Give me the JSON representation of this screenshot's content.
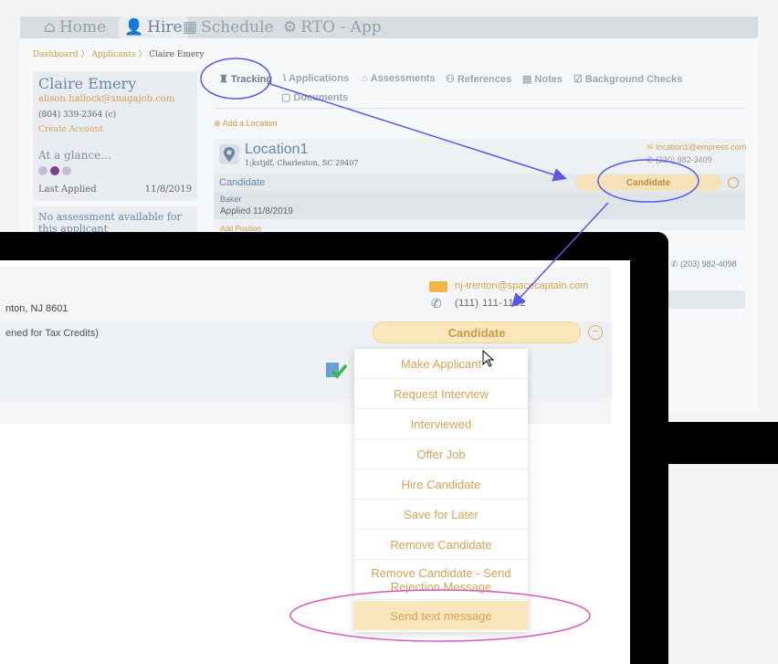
{
  "nav": {
    "home": "Home",
    "hire": "Hire",
    "schedule": "Schedule",
    "rto": "RTO - App"
  },
  "breadcrumb": {
    "dashboard": "Dashboard",
    "applicants": "Applicants",
    "current": "Claire Emery"
  },
  "applicant": {
    "name": "Claire Emery",
    "email": "alison.hallock@snagajob.com",
    "phone": "(804) 339-2364 (c)",
    "create_account": "Create Account",
    "glance": "At a glance...",
    "last_applied_label": "Last Applied",
    "last_applied_date": "11/8/2019",
    "no_assessment": "No assessment available for this applicant"
  },
  "tabs": {
    "tracking": "Tracking",
    "applications": "Applications",
    "assessments": "Assessments",
    "references": "References",
    "notes": "Notes",
    "background": "Background Checks",
    "documents": "Documents"
  },
  "location": {
    "add": "Add a Location",
    "name": "Location1",
    "address": "1;kstjdf, Charleston, SC 29407",
    "email": "location1@empress.com",
    "phone": "(230) 982-3409",
    "status_label": "Candidate",
    "status_button": "Candidate",
    "job": "Baker",
    "applied": "Applied 11/8/2019",
    "add_position": "Add Position",
    "right_phone": "(203) 982-4098"
  },
  "zoomed": {
    "address": "nton, NJ 8601",
    "email": "nj-trenton@spacecaptain.com",
    "phone": "(111) 111-1132",
    "tax_note": "ened for Tax Credits)",
    "status_button": "Candidate"
  },
  "menu": {
    "items": [
      "Make Applicant",
      "Request Interview",
      "Interviewed",
      "Offer Job",
      "Hire Candidate",
      "Save for Later",
      "Remove Candidate",
      "Remove Candidate - Send Rejection Message",
      "Send text message"
    ]
  },
  "colors": {
    "accent": "#d7a356",
    "annotation_blue": "#5b58e8",
    "annotation_pink": "#d857c2",
    "menu_highlight": "#f9e6bd"
  }
}
